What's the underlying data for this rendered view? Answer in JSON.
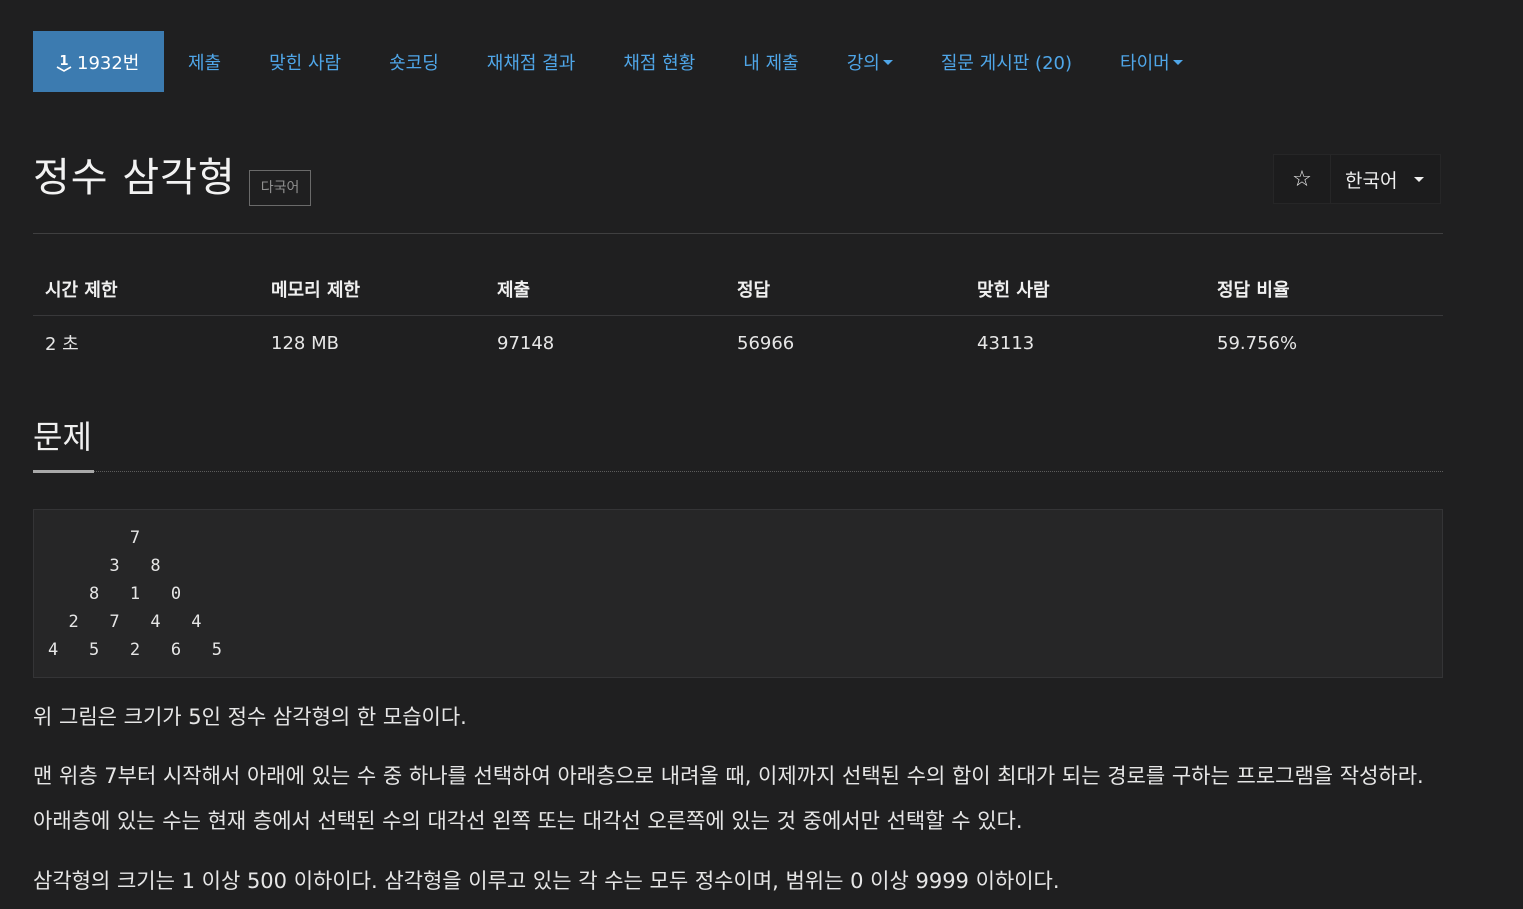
{
  "nav": {
    "problem_number": "1932번",
    "items": [
      {
        "label": "제출"
      },
      {
        "label": "맞힌 사람"
      },
      {
        "label": "숏코딩"
      },
      {
        "label": "재채점 결과"
      },
      {
        "label": "채점 현황"
      },
      {
        "label": "내 제출"
      },
      {
        "label": "강의",
        "dropdown": true
      },
      {
        "label": "질문 게시판 (20)"
      },
      {
        "label": "타이머",
        "dropdown": true
      }
    ],
    "tier_number": "1"
  },
  "problem": {
    "title": "정수 삼각형",
    "lang_tag": "다국어",
    "star_icon": "☆",
    "language": "한국어"
  },
  "info": {
    "headers": [
      "시간 제한",
      "메모리 제한",
      "제출",
      "정답",
      "맞힌 사람",
      "정답 비율"
    ],
    "values": [
      "2 초",
      "128 MB",
      "97148",
      "56966",
      "43113",
      "59.756%"
    ]
  },
  "section": {
    "title": "문제"
  },
  "triangle": "        7\n      3   8\n    8   1   0\n  2   7   4   4\n4   5   2   6   5",
  "body": {
    "p1": "위 그림은 크기가 5인 정수 삼각형의 한 모습이다.",
    "p2": "맨 위층 7부터 시작해서 아래에 있는 수 중 하나를 선택하여 아래층으로 내려올 때, 이제까지 선택된 수의 합이 최대가 되는 경로를 구하는 프로그램을 작성하라. 아래층에 있는 수는 현재 층에서 선택된 수의 대각선 왼쪽 또는 대각선 오른쪽에 있는 것 중에서만 선택할 수 있다.",
    "p3": "삼각형의 크기는 1 이상 500 이하이다. 삼각형을 이루고 있는 각 수는 모두 정수이며, 범위는 0 이상 9999 이하이다."
  },
  "colors": {
    "background": "#1f1f20",
    "nav_link": "#4fa6e8",
    "nav_active_bg": "#3c7bb0"
  }
}
